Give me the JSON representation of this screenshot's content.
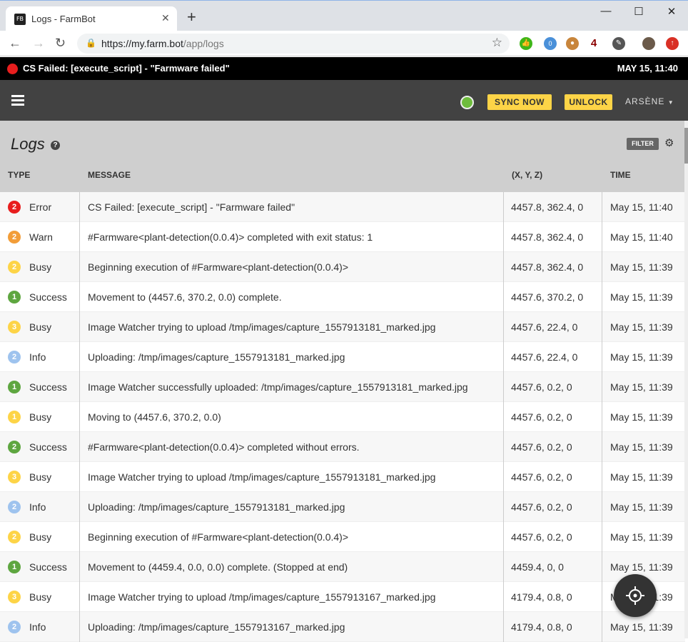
{
  "browser": {
    "tab_title": "Logs - FarmBot",
    "tab_favicon_label": "FB",
    "url_host": "https://my.farm.bot",
    "url_path": "/app/logs",
    "extensions": {
      "badge_green": "0",
      "badge_count": "4"
    }
  },
  "status_bar": {
    "message": "CS Failed: [execute_script] - \"Farmware failed\"",
    "time": "MAY 15, 11:40"
  },
  "navbar": {
    "sync_label": "SYNC NOW",
    "unlock_label": "UNLOCK",
    "user_label": "ARSÈNE"
  },
  "logs": {
    "title": "Logs",
    "filter_label": "FILTER",
    "columns": {
      "type": "TYPE",
      "message": "MESSAGE",
      "position": "(X, Y, Z)",
      "time": "TIME"
    },
    "rows": [
      {
        "level": "2",
        "type": "Error",
        "color": "#e81e1e",
        "message": "CS Failed: [execute_script] - \"Farmware failed\"",
        "position": "4457.8, 362.4, 0",
        "time": "May 15, 11:40"
      },
      {
        "level": "2",
        "type": "Warn",
        "color": "#f29d38",
        "message": "#Farmware<plant-detection(0.0.4)> completed with exit status: 1",
        "position": "4457.8, 362.4, 0",
        "time": "May 15, 11:40"
      },
      {
        "level": "2",
        "type": "Busy",
        "color": "#fdd447",
        "message": "Beginning execution of #Farmware<plant-detection(0.0.4)>",
        "position": "4457.8, 362.4, 0",
        "time": "May 15, 11:39"
      },
      {
        "level": "1",
        "type": "Success",
        "color": "#5ea640",
        "message": "Movement to (4457.6, 370.2, 0.0) complete.",
        "position": "4457.6, 370.2, 0",
        "time": "May 15, 11:39"
      },
      {
        "level": "3",
        "type": "Busy",
        "color": "#fdd447",
        "message": "Image Watcher trying to upload /tmp/images/capture_1557913181_marked.jpg",
        "position": "4457.6, 22.4, 0",
        "time": "May 15, 11:39"
      },
      {
        "level": "2",
        "type": "Info",
        "color": "#9ec3ee",
        "message": "Uploading: /tmp/images/capture_1557913181_marked.jpg",
        "position": "4457.6, 22.4, 0",
        "time": "May 15, 11:39"
      },
      {
        "level": "1",
        "type": "Success",
        "color": "#5ea640",
        "message": "Image Watcher successfully uploaded: /tmp/images/capture_1557913181_marked.jpg",
        "position": "4457.6, 0.2, 0",
        "time": "May 15, 11:39"
      },
      {
        "level": "1",
        "type": "Busy",
        "color": "#fdd447",
        "message": "Moving to (4457.6, 370.2, 0.0)",
        "position": "4457.6, 0.2, 0",
        "time": "May 15, 11:39"
      },
      {
        "level": "2",
        "type": "Success",
        "color": "#5ea640",
        "message": "#Farmware<plant-detection(0.0.4)> completed without errors.",
        "position": "4457.6, 0.2, 0",
        "time": "May 15, 11:39"
      },
      {
        "level": "3",
        "type": "Busy",
        "color": "#fdd447",
        "message": "Image Watcher trying to upload /tmp/images/capture_1557913181_marked.jpg",
        "position": "4457.6, 0.2, 0",
        "time": "May 15, 11:39"
      },
      {
        "level": "2",
        "type": "Info",
        "color": "#9ec3ee",
        "message": "Uploading: /tmp/images/capture_1557913181_marked.jpg",
        "position": "4457.6, 0.2, 0",
        "time": "May 15, 11:39"
      },
      {
        "level": "2",
        "type": "Busy",
        "color": "#fdd447",
        "message": "Beginning execution of #Farmware<plant-detection(0.0.4)>",
        "position": "4457.6, 0.2, 0",
        "time": "May 15, 11:39"
      },
      {
        "level": "1",
        "type": "Success",
        "color": "#5ea640",
        "message": "Movement to (4459.4, 0.0, 0.0) complete. (Stopped at end)",
        "position": "4459.4, 0, 0",
        "time": "May 15, 11:39"
      },
      {
        "level": "3",
        "type": "Busy",
        "color": "#fdd447",
        "message": "Image Watcher trying to upload /tmp/images/capture_1557913167_marked.jpg",
        "position": "4179.4, 0.8, 0",
        "time": "May 15, 11:39"
      },
      {
        "level": "2",
        "type": "Info",
        "color": "#9ec3ee",
        "message": "Uploading: /tmp/images/capture_1557913167_marked.jpg",
        "position": "4179.4, 0.8, 0",
        "time": "May 15, 11:39"
      }
    ]
  }
}
